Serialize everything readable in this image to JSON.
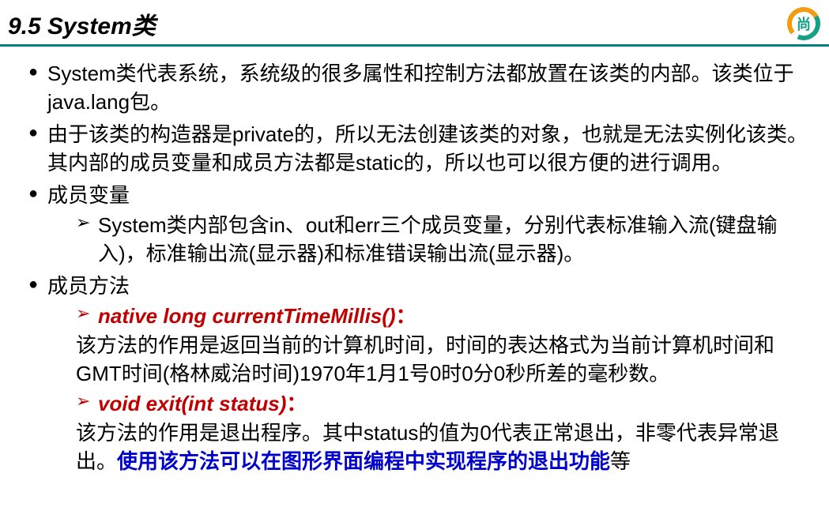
{
  "header": {
    "title": "9.5 System类",
    "logo_text": "尚"
  },
  "bullets": {
    "item1": "System类代表系统，系统级的很多属性和控制方法都放置在该类的内部。该类位于java.lang包。",
    "item2": "由于该类的构造器是private的，所以无法创建该类的对象，也就是无法实例化该类。其内部的成员变量和成员方法都是static的，所以也可以很方便的进行调用。",
    "item3": "成员变量",
    "item3_sub1": "System类内部包含in、out和err三个成员变量，分别代表标准输入流(键盘输入)，标准输出流(显示器)和标准错误输出流(显示器)。",
    "item4": "成员方法",
    "method1_name": "native long currentTimeMillis()",
    "method1_colon": "：",
    "method1_desc": "该方法的作用是返回当前的计算机时间，时间的表达格式为当前计算机时间和GMT时间(格林威治时间)1970年1月1号0时0分0秒所差的毫秒数。",
    "method2_name": "void exit(int status)",
    "method2_colon": "：",
    "method2_desc_part1": "该方法的作用是退出程序。其中status的值为0代表正常退出，非零代表异常退出。",
    "method2_desc_part2": "使用该方法可以在图形界面编程中实现程序的退出功能",
    "method2_desc_part3": "等"
  },
  "watermark": ""
}
